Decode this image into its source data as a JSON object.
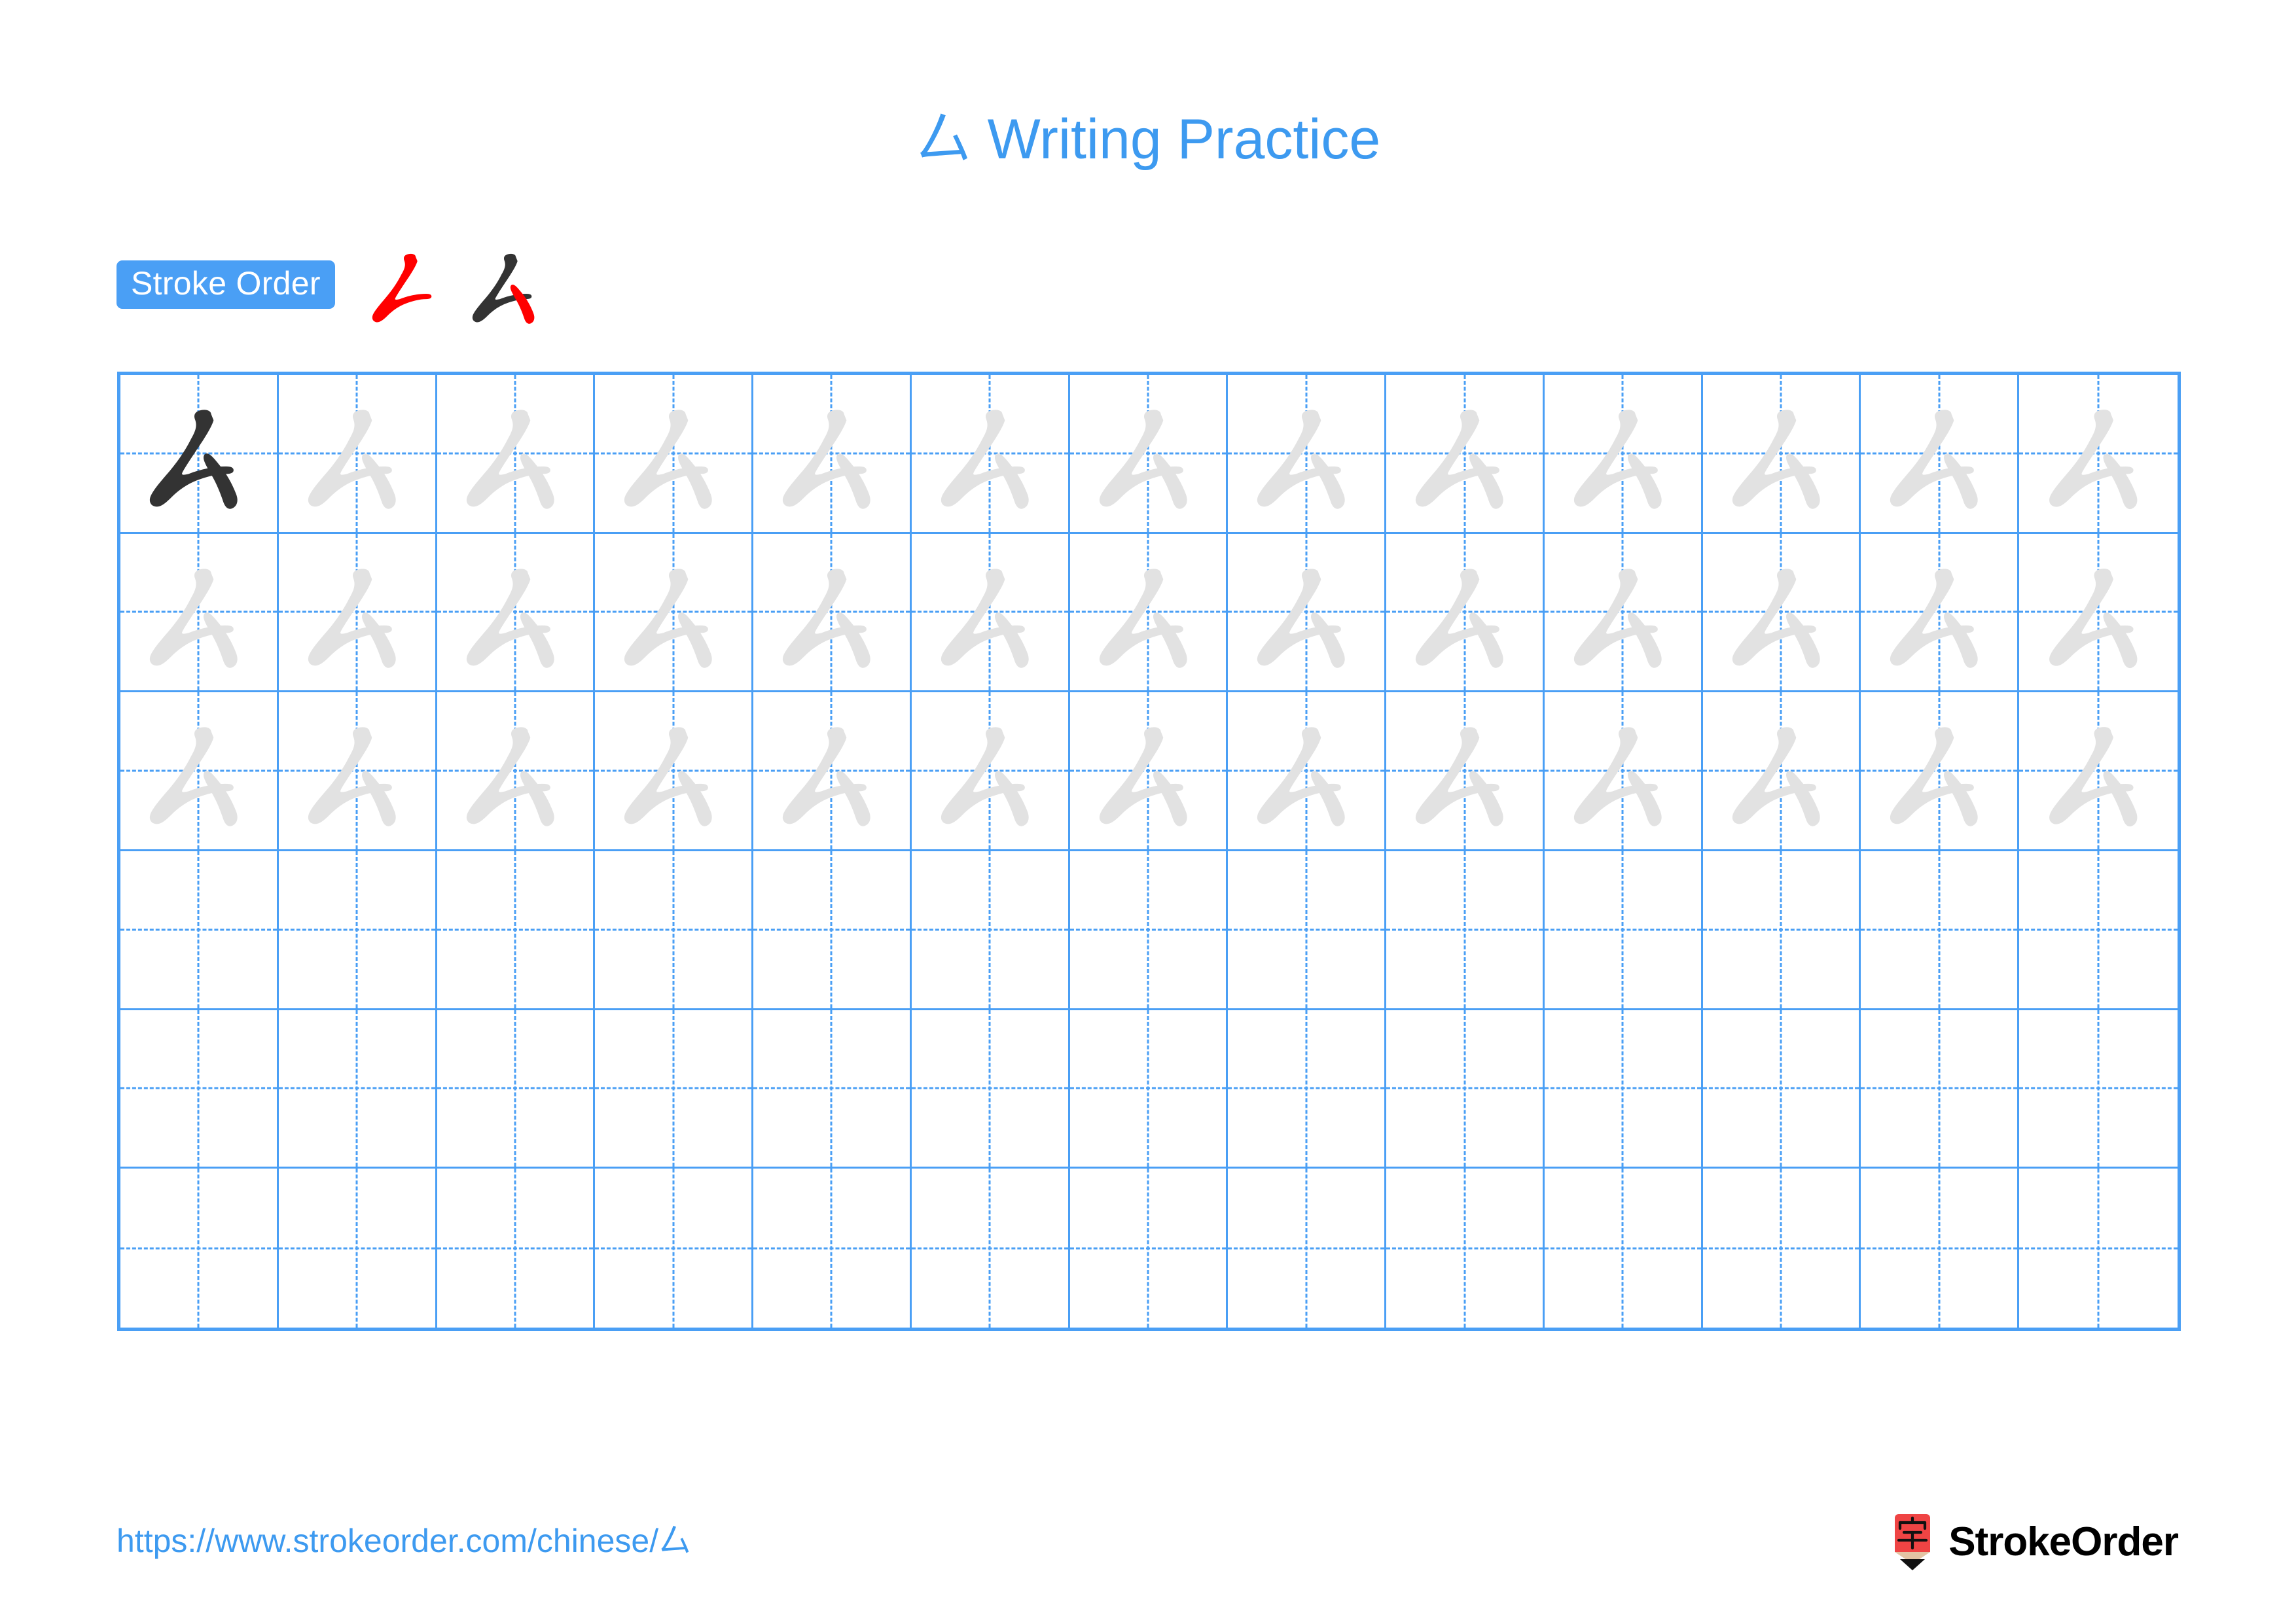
{
  "page": {
    "character": "厶",
    "title": "厶 Writing Practice",
    "title_prefix_char": "厶",
    "title_text": " Writing Practice",
    "background_color": "#ffffff",
    "accent_color": "#4a9ff5",
    "title_color": "#3d9af0"
  },
  "stroke_order": {
    "badge_label": "Stroke Order",
    "badge_bg_color": "#4a9ff5",
    "badge_text_color": "#ffffff",
    "new_stroke_color": "#ff0000",
    "done_stroke_color": "#333333",
    "total_strokes": 2,
    "steps": [
      {
        "index": 1,
        "name": "piezhe",
        "new_stroke": 1,
        "completed_strokes": []
      },
      {
        "index": 2,
        "name": "dian-na",
        "new_stroke": 2,
        "completed_strokes": [
          1
        ]
      }
    ]
  },
  "grid": {
    "columns": 13,
    "rows": 6,
    "border_color": "#4a9ff5",
    "guide_line_style": "dashed",
    "guide_line_color": "#4a9ff5",
    "dark_glyph_color": "#333333",
    "trace_glyph_color": "#e2e2e2",
    "cells_filled": [
      [
        "dark",
        "trace",
        "trace",
        "trace",
        "trace",
        "trace",
        "trace",
        "trace",
        "trace",
        "trace",
        "trace",
        "trace",
        "trace"
      ],
      [
        "trace",
        "trace",
        "trace",
        "trace",
        "trace",
        "trace",
        "trace",
        "trace",
        "trace",
        "trace",
        "trace",
        "trace",
        "trace"
      ],
      [
        "trace",
        "trace",
        "trace",
        "trace",
        "trace",
        "trace",
        "trace",
        "trace",
        "trace",
        "trace",
        "trace",
        "trace",
        "trace"
      ],
      [
        "empty",
        "empty",
        "empty",
        "empty",
        "empty",
        "empty",
        "empty",
        "empty",
        "empty",
        "empty",
        "empty",
        "empty",
        "empty"
      ],
      [
        "empty",
        "empty",
        "empty",
        "empty",
        "empty",
        "empty",
        "empty",
        "empty",
        "empty",
        "empty",
        "empty",
        "empty",
        "empty"
      ],
      [
        "empty",
        "empty",
        "empty",
        "empty",
        "empty",
        "empty",
        "empty",
        "empty",
        "empty",
        "empty",
        "empty",
        "empty",
        "empty"
      ]
    ]
  },
  "footer": {
    "url": "https://www.strokeorder.com/chinese/厶",
    "url_color": "#3d9af0",
    "brand_name": "StrokeOrder",
    "logo_char": "字",
    "logo_body_color": "#ef4444",
    "logo_tip_color": "#e3c4a4",
    "logo_point_color": "#111111"
  }
}
